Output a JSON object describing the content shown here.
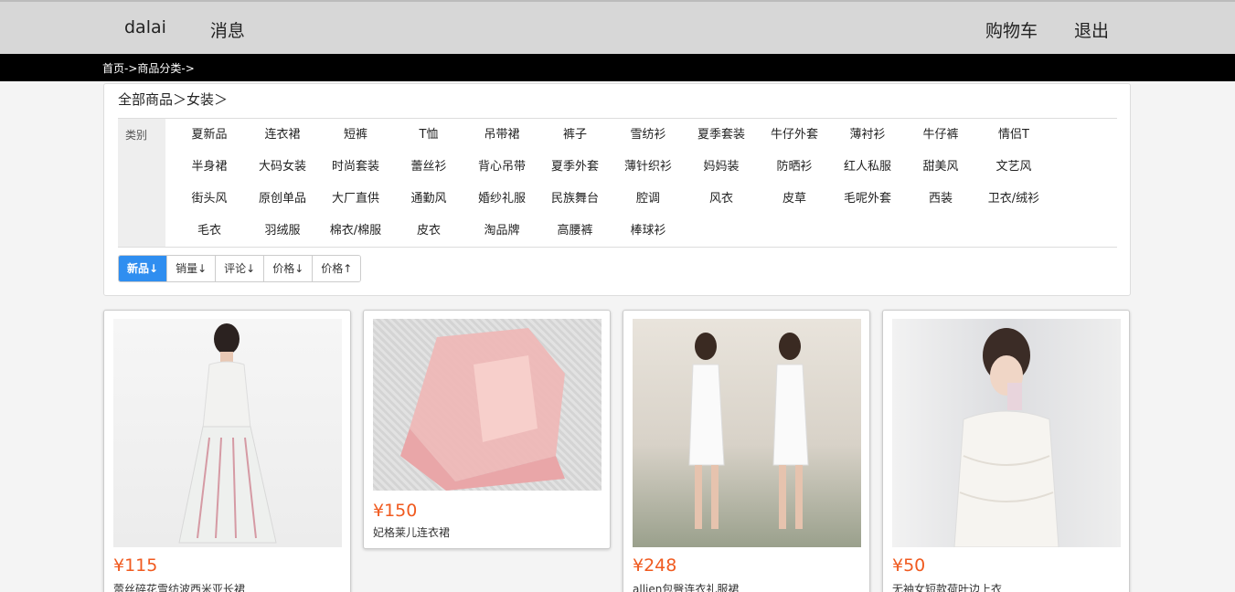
{
  "header": {
    "username": "dalai",
    "messages": "消息",
    "cart": "购物车",
    "logout": "退出"
  },
  "breadcrumb": "首页->商品分类->",
  "filter": {
    "path": "全部商品＞女装＞",
    "category_label": "类别",
    "categories": [
      "夏新品",
      "连衣裙",
      "短裤",
      "T恤",
      "吊带裙",
      "裤子",
      "雪纺衫",
      "夏季套装",
      "牛仔外套",
      "薄衬衫",
      "牛仔裤",
      "情侣T",
      "半身裙",
      "大码女装",
      "时尚套装",
      "蕾丝衫",
      "背心吊带",
      "夏季外套",
      "薄针织衫",
      "妈妈装",
      "防晒衫",
      "红人私服",
      "甜美风",
      "文艺风",
      "街头风",
      "原创单品",
      "大厂直供",
      "通勤风",
      "婚纱礼服",
      "民族舞台",
      "腔调",
      "风衣",
      "皮草",
      "毛呢外套",
      "西装",
      "卫衣/绒衫",
      "毛衣",
      "羽绒服",
      "棉衣/棉服",
      "皮衣",
      "淘品牌",
      "高腰裤",
      "棒球衫"
    ],
    "sort_options": [
      "新品↓",
      "销量↓",
      "评论↓",
      "价格↓",
      "价格↑"
    ]
  },
  "products": [
    {
      "price": "¥115",
      "name": "蕾丝碎花雪纺波西米亚长裙"
    },
    {
      "price": "¥150",
      "name": "妃格莱儿连衣裙"
    },
    {
      "price": "¥248",
      "name": "allien包臀连衣礼服裙"
    },
    {
      "price": "¥50",
      "name": "无袖女短款荷叶边上衣"
    }
  ],
  "colors": {
    "accent_blue": "#2f8ef0",
    "price_orange": "#f05a1f",
    "topbar_gray": "#d7d7d7"
  }
}
